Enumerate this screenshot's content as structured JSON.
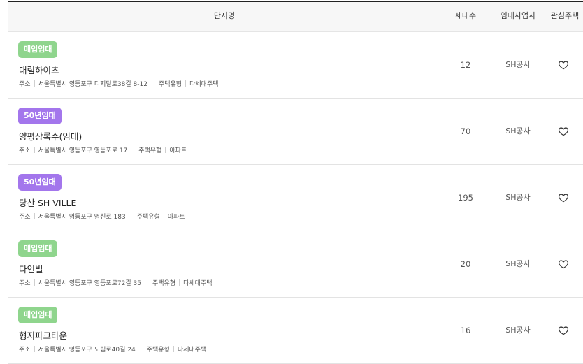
{
  "table": {
    "headers": {
      "name": "단지명",
      "units": "세대수",
      "operator": "임대사업자",
      "favorite": "관심주택"
    },
    "address_label": "주소",
    "type_label": "주택유형",
    "rows": [
      {
        "badge": "매입임대",
        "badge_color": "#8fd58d",
        "name": "대림하이츠",
        "address": "서울특별시 영등포구 디지털로38길 8-12",
        "housing_type": "다세대주택",
        "units": "12",
        "operator": "SH공사"
      },
      {
        "badge": "50년임대",
        "badge_color": "#a376ec",
        "name": "양평상록수(임대)",
        "address": "서울특별시 영등포구 영등포로 17",
        "housing_type": "아파트",
        "units": "70",
        "operator": "SH공사"
      },
      {
        "badge": "50년임대",
        "badge_color": "#a376ec",
        "name": "당산 SH VILLE",
        "address": "서울특별시 영등포구 영신로 183",
        "housing_type": "아파트",
        "units": "195",
        "operator": "SH공사"
      },
      {
        "badge": "매입임대",
        "badge_color": "#8fd58d",
        "name": "다인빌",
        "address": "서울특별시 영등포구 영등포로72길 35",
        "housing_type": "다세대주택",
        "units": "20",
        "operator": "SH공사"
      },
      {
        "badge": "매입임대",
        "badge_color": "#8fd58d",
        "name": "형지파크타운",
        "address": "서울특별시 영등포구 도림로40길 24",
        "housing_type": "다세대주택",
        "units": "16",
        "operator": "SH공사"
      }
    ],
    "favorite_icon": "heart-outline-icon"
  }
}
